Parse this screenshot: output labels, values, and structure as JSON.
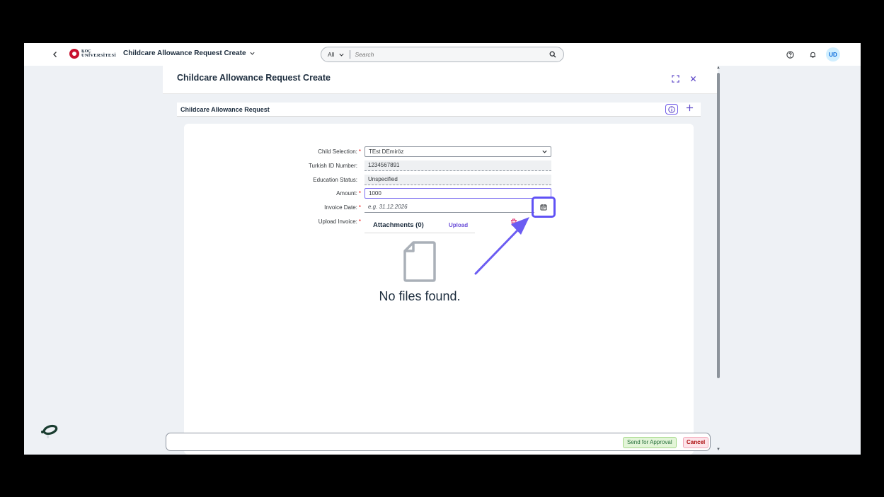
{
  "shell": {
    "back_icon": "chevron-left-icon",
    "logo_line1": "KOÇ",
    "logo_line2": "ÜNİVERSİTESİ",
    "app_title": "Childcare Allowance Request Create",
    "search": {
      "scope": "All",
      "placeholder": "Search"
    },
    "avatar_initials": "UD"
  },
  "dialog": {
    "title": "Childcare Allowance Request Create",
    "section_title": "Childcare Allowance Request",
    "form": {
      "child_selection": {
        "label": "Child Selection:",
        "value": "TEst DEmiröz",
        "required": true
      },
      "turkish_id": {
        "label": "Turkish ID Number:",
        "value": "1234567891"
      },
      "education_status": {
        "label": "Education Status:",
        "value": "Unspecified"
      },
      "amount": {
        "label": "Amount:",
        "value": "1000",
        "required": true
      },
      "invoice_date": {
        "label": "Invoice Date:",
        "placeholder": "e.g. 31.12.2026",
        "required": true
      },
      "upload_invoice": {
        "label": "Upload Invoice:",
        "required": true
      }
    },
    "attachments": {
      "title": "Attachments (0)",
      "upload_label": "Upload",
      "empty_text": "No files found."
    }
  },
  "footer": {
    "send_label": "Send for Approval",
    "cancel_label": "Cancel"
  },
  "colors": {
    "accent": "#5b45c7",
    "highlight": "#6052f5",
    "send_bg": "#e3f5d8",
    "cancel_bg": "#fde4ea"
  }
}
